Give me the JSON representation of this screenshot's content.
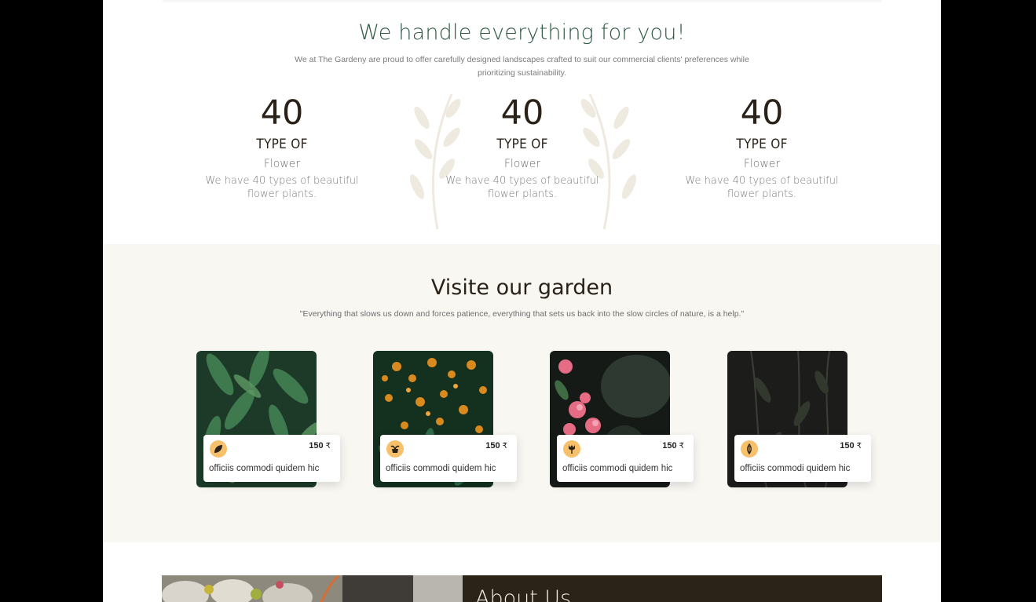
{
  "handle": {
    "title": "We handle everything for you!",
    "subtitle": "We at The Gardeny are proud to offer carefully designed landscapes crafted to suit our commercial clients' preferences while prioritizing sustainability."
  },
  "stats": [
    {
      "number": "40",
      "type": "TYPE OF",
      "sub": "Flower",
      "desc": "We have 40 types of beautiful flower plants."
    },
    {
      "number": "40",
      "type": "TYPE OF",
      "sub": "Flower",
      "desc": "We have 40 types of beautiful flower plants."
    },
    {
      "number": "40",
      "type": "TYPE OF",
      "sub": "Flower",
      "desc": "We have 40 types of beautiful flower plants."
    }
  ],
  "garden": {
    "title": "Visite our garden",
    "quote": "\"Everything that slows us down and forces patience, everything that sets us back into the slow circles of nature, is a help.\""
  },
  "cards": [
    {
      "icon": "leaf-icon",
      "price": "150",
      "currency": "₹",
      "name": "officiis commodi quidem hic"
    },
    {
      "icon": "pot-plant-icon",
      "price": "150",
      "currency": "₹",
      "name": "officiis commodi quidem hic"
    },
    {
      "icon": "tulip-icon",
      "price": "150",
      "currency": "₹",
      "name": "officiis commodi quidem hic"
    },
    {
      "icon": "sprout-icon",
      "price": "150",
      "currency": "₹",
      "name": "officiis commodi quidem hic"
    }
  ],
  "about": {
    "title": "About Us"
  },
  "colors": {
    "heading_green": "#2e5a44",
    "dark_text": "#2a2219",
    "garden_bg": "#f9f7f2",
    "icon_bg": "#f7c06a",
    "about_bg": "#2b2318"
  }
}
